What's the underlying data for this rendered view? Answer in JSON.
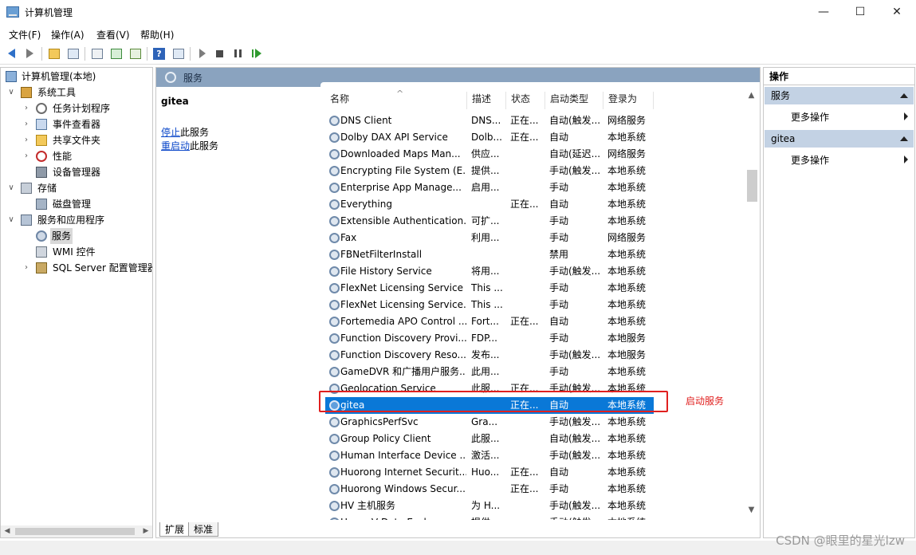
{
  "window": {
    "title": "计算机管理",
    "minimize": "—",
    "maximize": "☐",
    "close": "✕"
  },
  "menubar": [
    "文件(F)",
    "操作(A)",
    "查看(V)",
    "帮助(H)"
  ],
  "toolbar": {
    "buttons": [
      "back-icon",
      "forward-icon",
      "up-folder-icon",
      "show-hide-tree-icon",
      "properties-icon",
      "refresh-icon",
      "export-icon",
      "help-icon",
      "show-action-pane-icon",
      "start-service-icon",
      "stop-service-icon",
      "pause-service-icon",
      "resume-service-icon"
    ]
  },
  "tree": {
    "root": "计算机管理(本地)",
    "system_tools": "系统工具",
    "task_scheduler": "任务计划程序",
    "event_viewer": "事件查看器",
    "shared_folders": "共享文件夹",
    "performance": "性能",
    "device_manager": "设备管理器",
    "storage": "存储",
    "disk_management": "磁盘管理",
    "services_apps": "服务和应用程序",
    "services": "服务",
    "wmi": "WMI 控件",
    "sql": "SQL Server 配置管理器"
  },
  "middle": {
    "header": "服务",
    "selected_service": "gitea",
    "stop_link": "停止",
    "stop_suffix": "此服务",
    "restart_link": "重启动",
    "restart_suffix": "此服务",
    "columns": [
      "名称",
      "描述",
      "状态",
      "启动类型",
      "登录为"
    ],
    "rows": [
      {
        "name": "DNS Client",
        "desc": "DNS...",
        "state": "正在...",
        "start": "自动(触发...",
        "logon": "网络服务"
      },
      {
        "name": "Dolby DAX API Service",
        "desc": "Dolb...",
        "state": "正在...",
        "start": "自动",
        "logon": "本地系统"
      },
      {
        "name": "Downloaded Maps Man...",
        "desc": "供应...",
        "state": "",
        "start": "自动(延迟...",
        "logon": "网络服务"
      },
      {
        "name": "Encrypting File System (E...",
        "desc": "提供...",
        "state": "",
        "start": "手动(触发...",
        "logon": "本地系统"
      },
      {
        "name": "Enterprise App Manage...",
        "desc": "启用...",
        "state": "",
        "start": "手动",
        "logon": "本地系统"
      },
      {
        "name": "Everything",
        "desc": "",
        "state": "正在...",
        "start": "自动",
        "logon": "本地系统"
      },
      {
        "name": "Extensible Authentication...",
        "desc": "可扩...",
        "state": "",
        "start": "手动",
        "logon": "本地系统"
      },
      {
        "name": "Fax",
        "desc": "利用...",
        "state": "",
        "start": "手动",
        "logon": "网络服务"
      },
      {
        "name": "FBNetFilterInstall",
        "desc": "",
        "state": "",
        "start": "禁用",
        "logon": "本地系统"
      },
      {
        "name": "File History Service",
        "desc": "将用...",
        "state": "",
        "start": "手动(触发...",
        "logon": "本地系统"
      },
      {
        "name": "FlexNet Licensing Service",
        "desc": "This ...",
        "state": "",
        "start": "手动",
        "logon": "本地系统"
      },
      {
        "name": "FlexNet Licensing Service...",
        "desc": "This ...",
        "state": "",
        "start": "手动",
        "logon": "本地系统"
      },
      {
        "name": "Fortemedia APO Control ...",
        "desc": "Fort...",
        "state": "正在...",
        "start": "自动",
        "logon": "本地系统"
      },
      {
        "name": "Function Discovery Provi...",
        "desc": "FDP...",
        "state": "",
        "start": "手动",
        "logon": "本地服务"
      },
      {
        "name": "Function Discovery Reso...",
        "desc": "发布...",
        "state": "",
        "start": "手动(触发...",
        "logon": "本地服务"
      },
      {
        "name": "GameDVR 和广播用户服务...",
        "desc": "此用...",
        "state": "",
        "start": "手动",
        "logon": "本地系统"
      },
      {
        "name": "Geolocation Service",
        "desc": "此服...",
        "state": "正在...",
        "start": "手动(触发...",
        "logon": "本地系统"
      },
      {
        "name": "gitea",
        "desc": "",
        "state": "正在...",
        "start": "自动",
        "logon": "本地系统"
      },
      {
        "name": "GraphicsPerfSvc",
        "desc": "Gra...",
        "state": "",
        "start": "手动(触发...",
        "logon": "本地系统"
      },
      {
        "name": "Group Policy Client",
        "desc": "此服...",
        "state": "",
        "start": "自动(触发...",
        "logon": "本地系统"
      },
      {
        "name": "Human Interface Device ...",
        "desc": "激活...",
        "state": "",
        "start": "手动(触发...",
        "logon": "本地系统"
      },
      {
        "name": "Huorong Internet Securit...",
        "desc": "Huo...",
        "state": "正在...",
        "start": "自动",
        "logon": "本地系统"
      },
      {
        "name": "Huorong Windows Secur...",
        "desc": "",
        "state": "正在...",
        "start": "手动",
        "logon": "本地系统"
      },
      {
        "name": "HV 主机服务",
        "desc": "为 H...",
        "state": "",
        "start": "手动(触发...",
        "logon": "本地系统"
      },
      {
        "name": "Hyper-V Data Exchange...",
        "desc": "提供...",
        "state": "",
        "start": "手动(触发...",
        "logon": "本地系统"
      }
    ],
    "tabs": [
      "扩展",
      "标准"
    ]
  },
  "annotation": "启动服务",
  "actions": {
    "title": "操作",
    "section1": "服务",
    "section1_item": "更多操作",
    "section2": "gitea",
    "section2_item": "更多操作"
  },
  "watermark": "CSDN @眼里的星光lzw",
  "colors": {
    "selection": "#0a78d7",
    "pane_header": "#8aa3bf",
    "action_section": "#c3d2e4",
    "annotation": "#e0201f",
    "link": "#0b47c9"
  }
}
